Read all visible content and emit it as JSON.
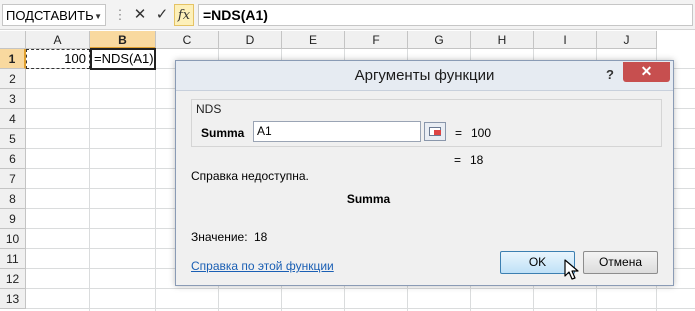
{
  "formula_bar": {
    "name_box": "ПОДСТАВИТЬ",
    "name_box_icon": "chevron-down-icon",
    "cancel_glyph": "✕",
    "enter_glyph": "✓",
    "fx_glyph": "fx",
    "formula": "=NDS(A1)"
  },
  "sheet": {
    "columns": [
      "A",
      "B",
      "C",
      "D",
      "E",
      "F",
      "G",
      "H",
      "I",
      "J"
    ],
    "selected_column": "B",
    "rows": [
      "1",
      "2",
      "3",
      "4",
      "5",
      "6",
      "7",
      "8",
      "9",
      "10",
      "11",
      "12",
      "13"
    ],
    "selected_row": "1",
    "cells": {
      "A1": "100",
      "B1": "=NDS(A1)"
    }
  },
  "dialog": {
    "title": "Аргументы функции",
    "help_glyph": "?",
    "close_glyph": "✕",
    "function_name": "NDS",
    "argument": {
      "label": "Summa",
      "value": "A1",
      "equals": "=",
      "evaluated": "100"
    },
    "result_equals": "=",
    "result": "18",
    "help_text": "Справка недоступна.",
    "arg_description_name": "Summa",
    "value_label": "Значение:",
    "value": "18",
    "help_link": "Справка по этой функции",
    "ok_label": "OK",
    "cancel_label": "Отмена",
    "accent_color": "#c74f4f"
  }
}
